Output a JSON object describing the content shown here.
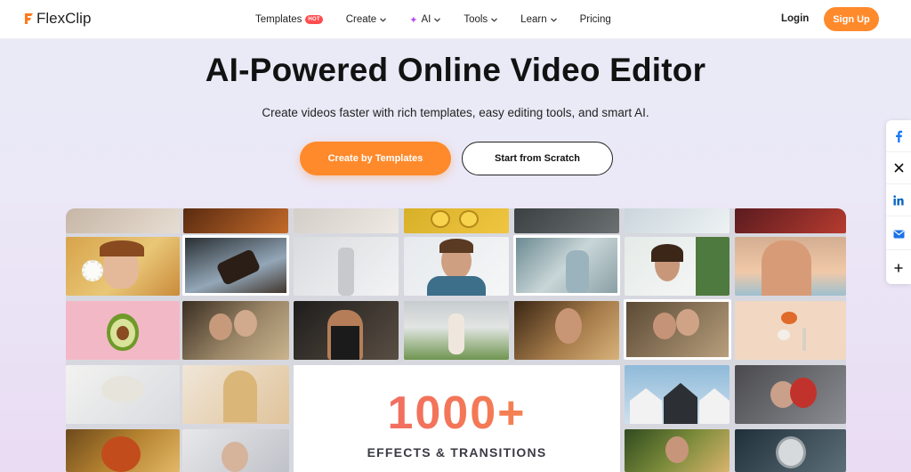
{
  "brand": {
    "name": "FlexClip",
    "accent": "#ff8a2b",
    "hot_color": "#ff4d4f"
  },
  "nav": {
    "items": [
      {
        "label": "Templates",
        "badge": "HOT",
        "dropdown": false
      },
      {
        "label": "Create",
        "dropdown": true
      },
      {
        "label": "AI",
        "icon": "sparkle-icon",
        "dropdown": true
      },
      {
        "label": "Tools",
        "dropdown": true
      },
      {
        "label": "Learn",
        "dropdown": true
      },
      {
        "label": "Pricing",
        "dropdown": false
      }
    ],
    "login": "Login",
    "signup": "Sign Up"
  },
  "hero": {
    "title": "AI-Powered Online Video Editor",
    "subtitle": "Create videos faster with rich templates, easy editing tools, and smart AI.",
    "primary_button": "Create by Templates",
    "secondary_button": "Start from Scratch"
  },
  "share": {
    "items": [
      {
        "name": "facebook-icon",
        "glyph": "f",
        "color": "#1877f2"
      },
      {
        "name": "x-icon",
        "glyph": "𝕏",
        "color": "#111111"
      },
      {
        "name": "linkedin-icon",
        "glyph": "in",
        "color": "#0a66c2"
      },
      {
        "name": "email-icon",
        "glyph": "✉",
        "color": "#1a73e8"
      },
      {
        "name": "plus-icon",
        "glyph": "+",
        "color": "#222222"
      }
    ]
  },
  "showcase": {
    "headline": "1000+",
    "caption": "EFFECTS & TRANSITIONS"
  }
}
